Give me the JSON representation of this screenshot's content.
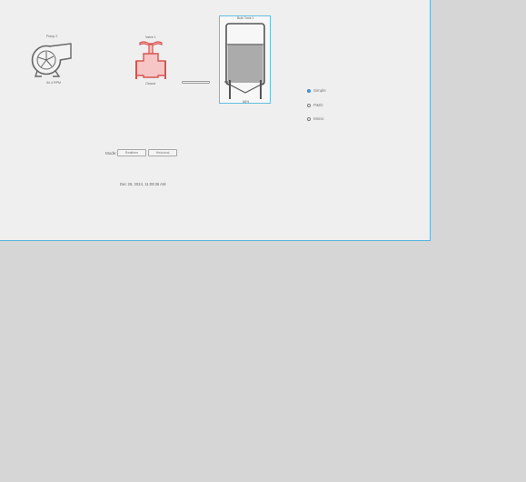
{
  "pump": {
    "title": "Pump 2",
    "status": "54.4 RPM",
    "icon": "pump-icon"
  },
  "valve": {
    "title": "Valve 1",
    "status": "Closed",
    "icon": "valve-icon",
    "color": "#d9534f"
  },
  "tank": {
    "title": "Bulk Tank 1",
    "level_label": "68%",
    "level_fraction": 0.68,
    "icon": "tank-icon"
  },
  "progress": {
    "fraction": 0.0
  },
  "view_options": [
    {
      "label": "Simple",
      "checked": true
    },
    {
      "label": "P&ID",
      "checked": false
    },
    {
      "label": "Mimic",
      "checked": false
    }
  ],
  "mode": {
    "label": "Mode:",
    "buttons": [
      "Realtime",
      "Historical"
    ]
  },
  "timestamp": "Dec 28, 2024, 11:09:36 AM",
  "colors": {
    "canvas": "#efefef",
    "frame": "#55b6e0",
    "background": "#d6d6d6"
  }
}
